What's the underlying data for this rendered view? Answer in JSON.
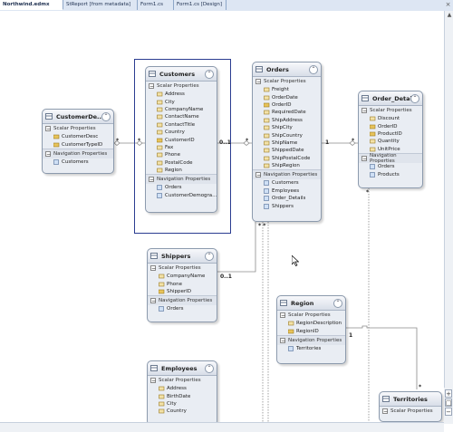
{
  "tabs": [
    {
      "label": "Northwind.edmx",
      "active": true
    },
    {
      "label": "StReport [from metadata]",
      "active": false
    },
    {
      "label": "Form1.cs",
      "active": false
    },
    {
      "label": "Form1.cs [Design]",
      "active": false
    }
  ],
  "tab_close": "×",
  "entities": {
    "customer_demographics": {
      "title": "CustomerDe...",
      "scalar_label": "Scalar Properties",
      "scalar": [
        "CustomerDesc",
        "CustomerTypeID"
      ],
      "nav_label": "Navigation Properties",
      "nav": [
        "Customers"
      ]
    },
    "customers": {
      "title": "Customers",
      "scalar_label": "Scalar Properties",
      "scalar": [
        "Address",
        "City",
        "CompanyName",
        "ContactName",
        "ContactTitle",
        "Country",
        "CustomerID",
        "Fax",
        "Phone",
        "PostalCode",
        "Region"
      ],
      "nav_label": "Navigation Properties",
      "nav": [
        "Orders",
        "CustomerDemogra..."
      ]
    },
    "orders": {
      "title": "Orders",
      "scalar_label": "Scalar Properties",
      "scalar": [
        "Freight",
        "OrderDate",
        "OrderID",
        "RequiredDate",
        "ShipAddress",
        "ShipCity",
        "ShipCountry",
        "ShipName",
        "ShippedDate",
        "ShipPostalCode",
        "ShipRegion"
      ],
      "nav_label": "Navigation Properties",
      "nav": [
        "Customers",
        "Employees",
        "Order_Details",
        "Shippers"
      ]
    },
    "order_details": {
      "title": "Order_Details",
      "scalar_label": "Scalar Properties",
      "scalar": [
        "Discount",
        "OrderID",
        "ProductID",
        "Quantity",
        "UnitPrice"
      ],
      "nav_label": "Navigation Properties",
      "nav": [
        "Orders",
        "Products"
      ]
    },
    "shippers": {
      "title": "Shippers",
      "scalar_label": "Scalar Properties",
      "scalar": [
        "CompanyName",
        "Phone",
        "ShipperID"
      ],
      "nav_label": "Navigation Properties",
      "nav": [
        "Orders"
      ]
    },
    "region": {
      "title": "Region",
      "scalar_label": "Scalar Properties",
      "scalar": [
        "RegionDescription",
        "RegionID"
      ],
      "nav_label": "Navigation Properties",
      "nav": [
        "Territories"
      ]
    },
    "employees": {
      "title": "Employees",
      "scalar_label": "Scalar Properties",
      "scalar": [
        "Address",
        "BirthDate",
        "City",
        "Country"
      ]
    },
    "territories": {
      "title": "Territories",
      "scalar_label": "Scalar Properties"
    }
  },
  "multiplicity": {
    "cd_left": "*",
    "cust_cd": "*",
    "cust_orders": "0..1",
    "orders_cust": "*",
    "orders_od": "1",
    "od_orders": "*",
    "shippers_orders": "0..1",
    "orders_bottom": "* *",
    "od_bottom": "*",
    "region_terr": "1",
    "terr_top": "*"
  },
  "zoom": {
    "plus": "+",
    "minus": "−"
  },
  "colors": {
    "selection": "#2b3d91",
    "entity_bg": "#e9edf3",
    "connector": "#8a8a8a"
  }
}
